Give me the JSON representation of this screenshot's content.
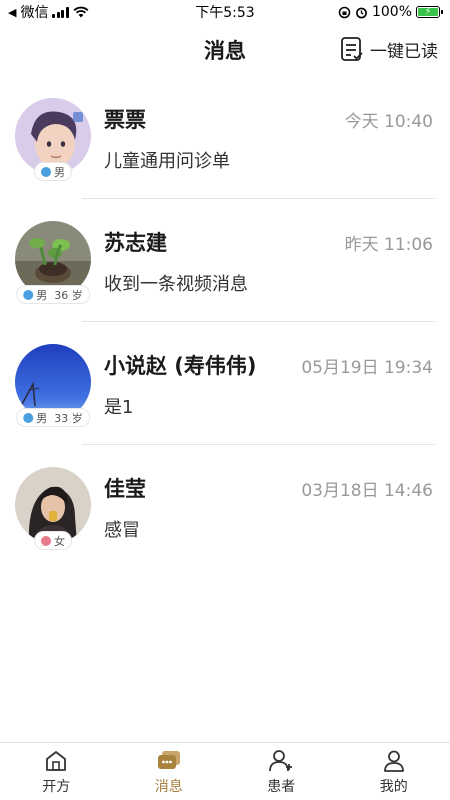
{
  "status_bar": {
    "carrier": "微信",
    "time": "下午5:53",
    "battery": "100%"
  },
  "header": {
    "title": "消息",
    "mark_all_read": "一键已读"
  },
  "messages": [
    {
      "name": "票票",
      "time": "今天 10:40",
      "preview": "儿童通用问诊单",
      "gender": "男",
      "age": ""
    },
    {
      "name": "苏志建",
      "time": "昨天 11:06",
      "preview": "收到一条视频消息",
      "gender": "男",
      "age": "36 岁"
    },
    {
      "name": "小说赵 (寿伟伟)",
      "time": "05月19日 19:34",
      "preview": "是1",
      "gender": "男",
      "age": "33 岁"
    },
    {
      "name": "佳莹",
      "time": "03月18日 14:46",
      "preview": "感冒",
      "gender": "女",
      "age": ""
    }
  ],
  "tabbar": {
    "tabs": [
      {
        "label": "开方",
        "icon": "house-icon"
      },
      {
        "label": "消息",
        "icon": "message-icon"
      },
      {
        "label": "患者",
        "icon": "patient-icon"
      },
      {
        "label": "我的",
        "icon": "profile-icon"
      }
    ],
    "active": "消息"
  },
  "colors": {
    "accent": "#a8813c",
    "male": "#4a9fe0",
    "female": "#e87a8c",
    "battery": "#38c24a"
  }
}
